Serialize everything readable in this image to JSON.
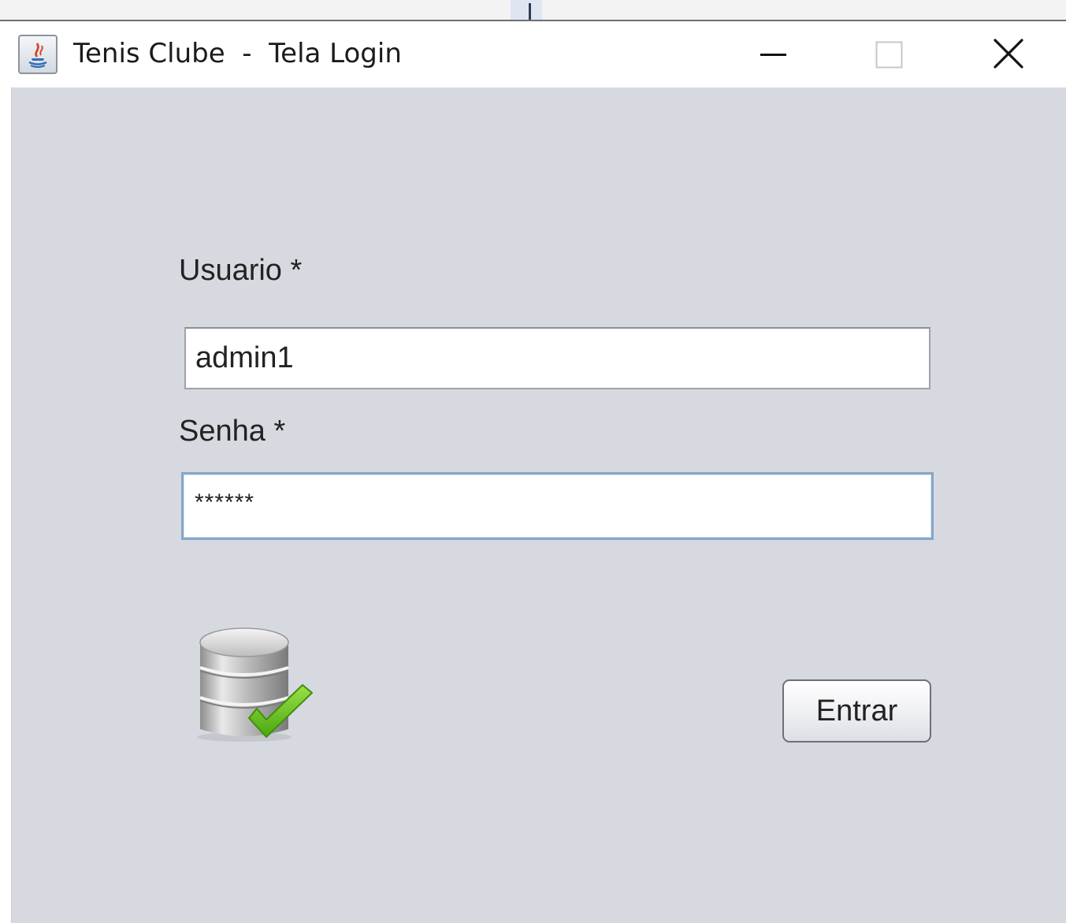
{
  "window": {
    "title": "Tenis Clube  -  Tela Login",
    "controls": {
      "minimize_icon": "minimize-icon",
      "maximize_icon": "maximize-icon",
      "close_icon": "close-icon"
    },
    "app_icon": "java-icon"
  },
  "form": {
    "username_label": "Usuario *",
    "username_value": "admin1",
    "password_label": "Senha *",
    "password_value": "******",
    "status_icon": "database-check-icon",
    "submit_label": "Entrar"
  },
  "colors": {
    "content_background": "#d6d9e0",
    "titlebar_background": "#ffffff",
    "focus_border": "#86a6c9",
    "check_green": "#6cc418"
  }
}
